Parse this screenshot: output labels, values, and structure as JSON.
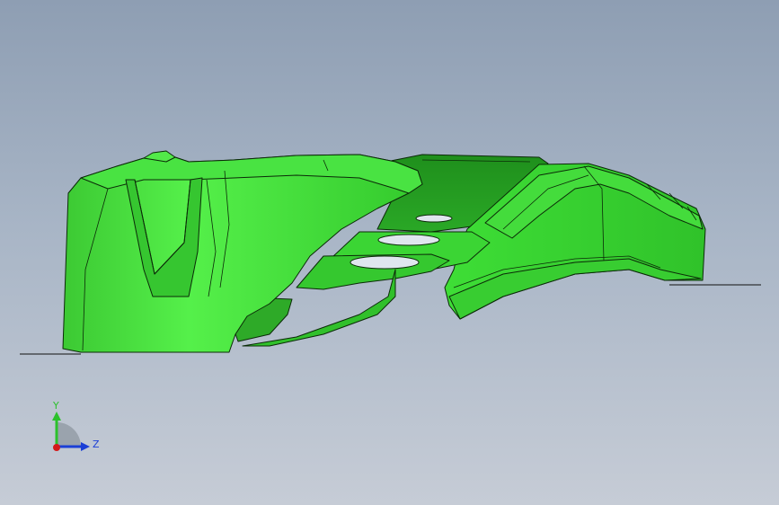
{
  "viewport": {
    "name": "3d-model-viewport",
    "model_color": "#3fe23a",
    "model_edge_color": "#0b2a08",
    "background_top": "#8e9eb3",
    "background_bottom": "#c6ccd6"
  },
  "triad": {
    "y_label": "Y",
    "z_label": "Z",
    "y_color": "#2cc12c",
    "z_color": "#1b3fd6",
    "x_color": "#d41a1a"
  }
}
